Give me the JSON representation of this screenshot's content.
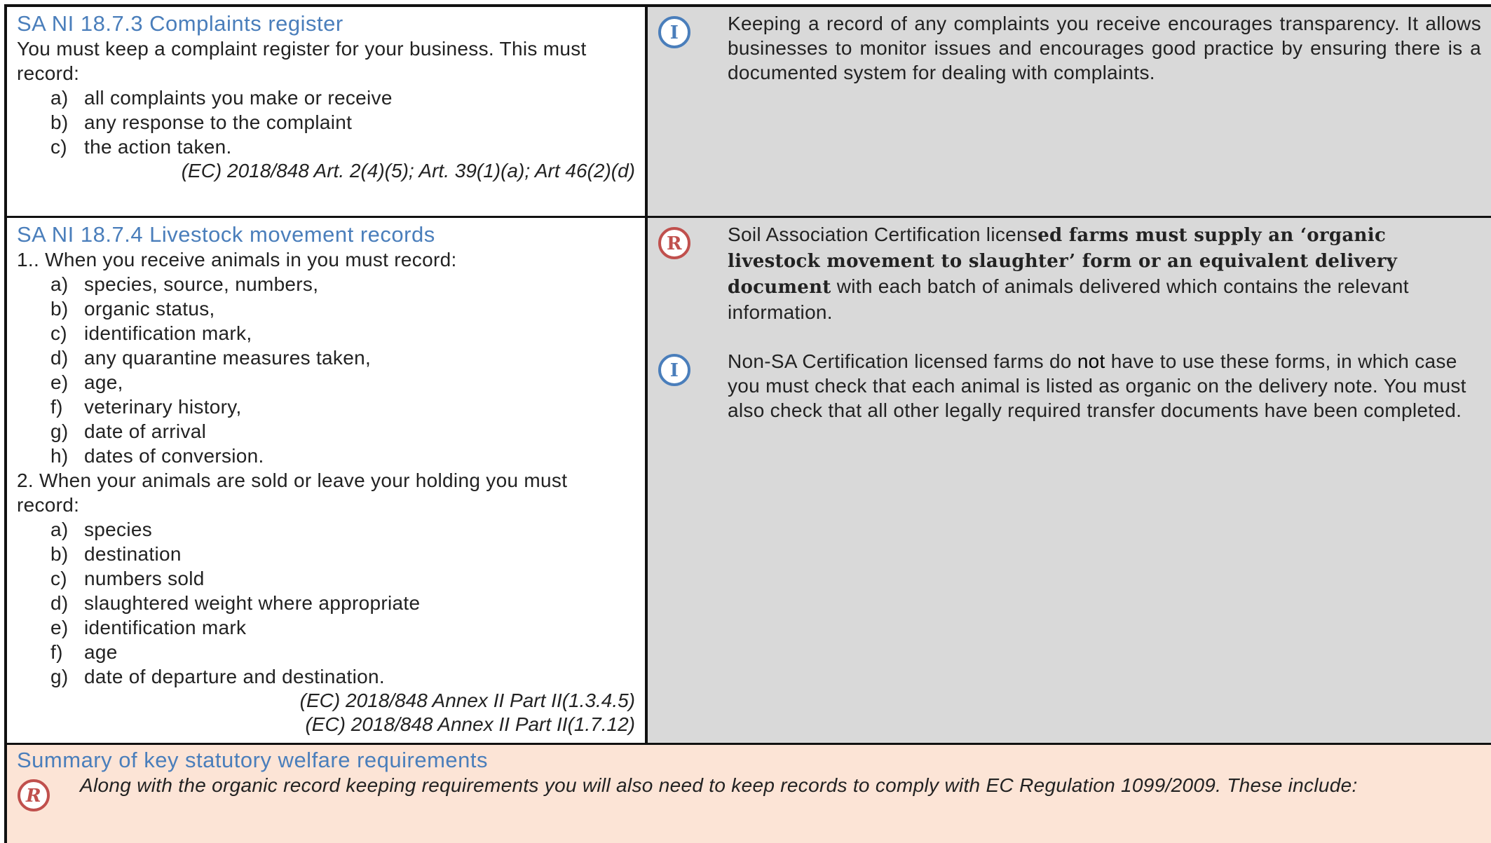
{
  "colors": {
    "heading": "#4a7ebb",
    "info_icon": "#4a7ebb",
    "rule_icon": "#c0504d",
    "grey_panel": "#d9d9d9",
    "summary_bg": "#fce4d6"
  },
  "icons": {
    "info": "I",
    "rule": "R"
  },
  "section1": {
    "heading": "SA NI 18.7.3 Complaints register",
    "intro": "You must keep a complaint register for your business. This must record:",
    "items": [
      {
        "marker": "a)",
        "text": "all complaints you make or receive"
      },
      {
        "marker": "b)",
        "text": "any response to the complaint"
      },
      {
        "marker": "c)",
        "text": "the action taken."
      }
    ],
    "reference": "(EC) 2018/848 Art. 2(4)(5); Art. 39(1)(a); Art 46(2)(d)",
    "info_note": "Keeping a record of any complaints you receive encourages transparency. It allows businesses to monitor issues and encourages good practice by ensuring there is a documented system for dealing with complaints."
  },
  "section2": {
    "heading": "SA NI 18.7.4 Livestock movement records",
    "intro1": "1.. When you receive animals in you must record:",
    "items1": [
      {
        "marker": "a)",
        "text": "species, source, numbers,"
      },
      {
        "marker": "b)",
        "text": "organic status,"
      },
      {
        "marker": "c)",
        "text": "identification mark,"
      },
      {
        "marker": "d)",
        "text": "any quarantine measures taken,"
      },
      {
        "marker": "e)",
        "text": "age,"
      },
      {
        "marker": "f)",
        "text": "veterinary history,"
      },
      {
        "marker": "g)",
        "text": "date of arrival"
      },
      {
        "marker": "h)",
        "text": "dates of conversion."
      }
    ],
    "intro2": "2. When your animals are sold or leave your holding you must record:",
    "items2": [
      {
        "marker": "a)",
        "text": "species"
      },
      {
        "marker": "b)",
        "text": "destination"
      },
      {
        "marker": "c)",
        "text": "numbers sold"
      },
      {
        "marker": "d)",
        "text": "slaughtered weight where appropriate"
      },
      {
        "marker": "e)",
        "text": "identification mark"
      },
      {
        "marker": "f)",
        "text": "age"
      },
      {
        "marker": "g)",
        "text": "date of departure and destination."
      }
    ],
    "references": [
      "(EC) 2018/848 Annex II Part II(1.3.4.5)",
      "(EC) 2018/848 Annex II Part II(1.7.12)"
    ],
    "rule_note_start": "Soil Association Certification licens",
    "rule_note_bold": "ed farms must supply an ‘organic livestock movement to slaughter’ form or an equivalent delivery document",
    "rule_note_end": " with each batch of animals delivered which contains the relevant information.",
    "info_note_start": "Non-SA Certification licensed farms do ",
    "info_note_emph": "not",
    "info_note_end": " have to use these forms, in which case you must check that each animal is listed as organic on the delivery note. You must also check that all other legally required transfer documents have been completed."
  },
  "summary": {
    "heading": "Summary of key statutory welfare requirements",
    "text": "Along with the organic record keeping requirements you will also need to keep records to comply with EC Regulation 1099/2009. These include:"
  }
}
